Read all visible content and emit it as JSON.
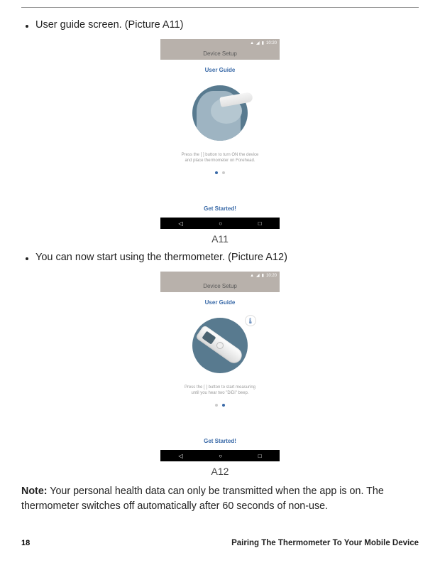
{
  "bullets": {
    "a11": "User guide screen. (Picture A11)",
    "a12": "You can now start using the thermometer. (Picture A12)"
  },
  "figures": {
    "a11": {
      "label": "A11"
    },
    "a12": {
      "label": "A12"
    }
  },
  "phone": {
    "statusbar": {
      "time": "10:20"
    },
    "titlebar": "Device Setup",
    "user_guide": "User Guide",
    "get_started": "Get Started!",
    "a11_instruction": "Press the [ ] button to turn ON the device\nand place thermometer on Forehead.",
    "a12_instruction": "Press the [ ] button to start measuring\nuntil you hear two \"DiDi\" beep.",
    "tip_glyph": "🌡"
  },
  "nav_glyphs": {
    "back": "◁",
    "home": "○",
    "recent": "□"
  },
  "note": {
    "label": "Note:",
    "body": " Your personal health data can only be transmitted when the app is on. The thermometer switches off automatically after 60 seconds of non-use."
  },
  "footer": {
    "page": "18",
    "title": "Pairing The Thermometer To Your Mobile Device"
  }
}
